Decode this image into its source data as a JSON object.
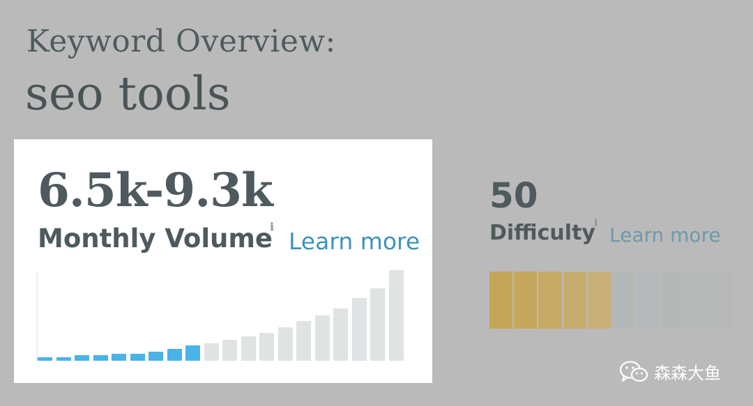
{
  "header": {
    "title_line1": "Keyword Overview:",
    "title_line2": "seo tools"
  },
  "volume": {
    "value": "6.5k-9.3k",
    "label": "Monthly Volume",
    "info_icon": "i",
    "learn_more": "Learn more"
  },
  "difficulty": {
    "value": "50",
    "label": "Difficulty",
    "info_icon": "i",
    "learn_more": "Learn more",
    "level": 50,
    "segments": 10,
    "filled_colors": [
      "#c4a457",
      "#c5a75e",
      "#c6aa66",
      "#c7ad6d",
      "#c8b078"
    ],
    "empty_color": "#b5b8b8"
  },
  "chart_data": {
    "type": "bar",
    "title": "",
    "xlabel": "",
    "ylabel": "",
    "ylim": [
      0,
      100
    ],
    "values": [
      4,
      4,
      6,
      6,
      8,
      8,
      10,
      13,
      17,
      19,
      23,
      27,
      31,
      37,
      44,
      50,
      58,
      69,
      80,
      100
    ],
    "highlighted_count": 9,
    "colors": {
      "highlight": "#4ab3e8",
      "rest": "#dfe3e3"
    }
  },
  "watermark": {
    "icon": "wechat-icon",
    "text": "森森大鱼"
  }
}
